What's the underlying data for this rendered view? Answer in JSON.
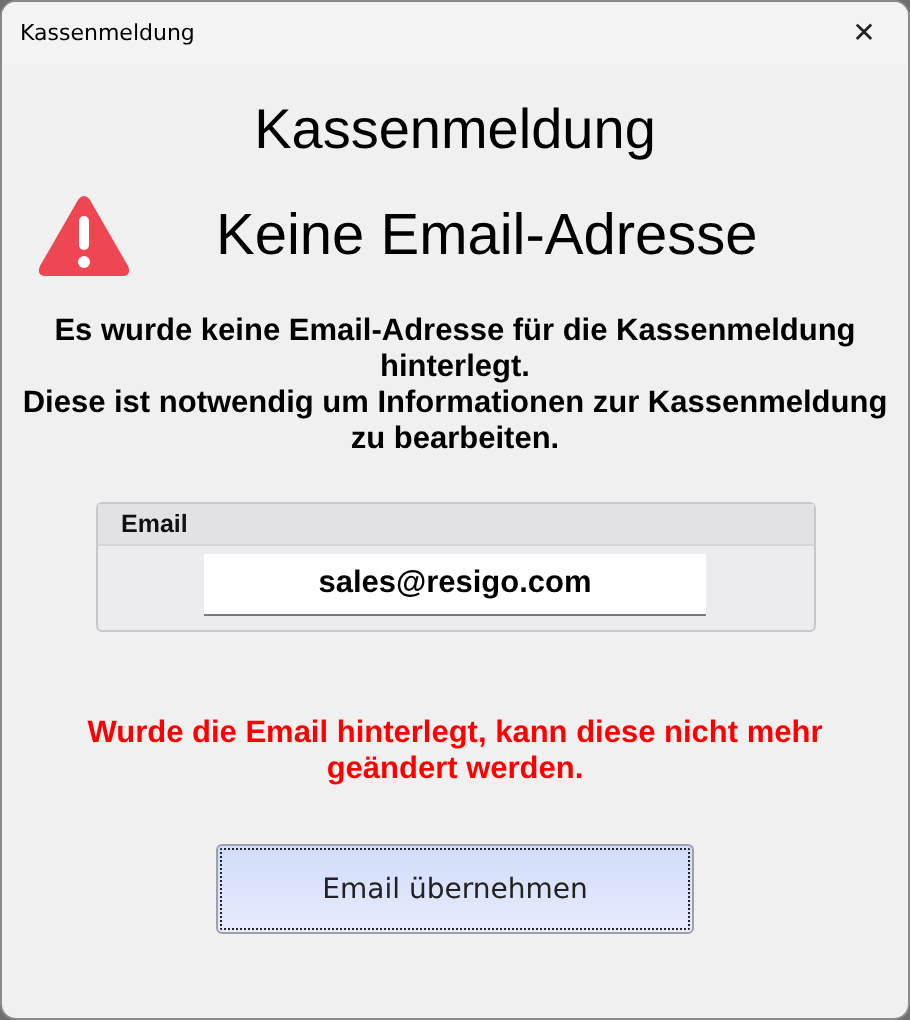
{
  "window": {
    "title": "Kassenmeldung",
    "close": "✕"
  },
  "heading": "Kassenmeldung",
  "alert": {
    "title": "Keine Email-Adresse"
  },
  "message": [
    "Es wurde keine Email-Adresse für die Kassenmeldung hinterlegt.",
    "Diese ist notwendig um Informationen zur Kassenmeldung zu bearbeiten."
  ],
  "email_group": {
    "label": "Email",
    "value": "sales@resigo.com"
  },
  "warning": "Wurde die Email hinterlegt, kann diese nicht mehr geändert werden.",
  "buttons": [
    "Email übernehmen"
  ]
}
